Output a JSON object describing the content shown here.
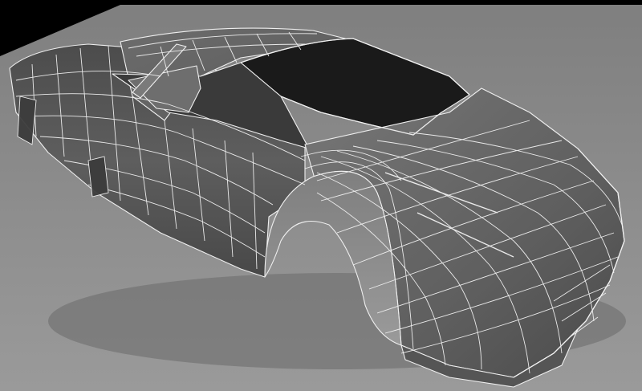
{
  "viewport": {
    "background_color": "#000000",
    "floor_color": "#8e8e8e",
    "body_color": "#5a5a5a",
    "wire_color": "#e8e8e8",
    "object": "car-body-wireframe-mesh"
  }
}
